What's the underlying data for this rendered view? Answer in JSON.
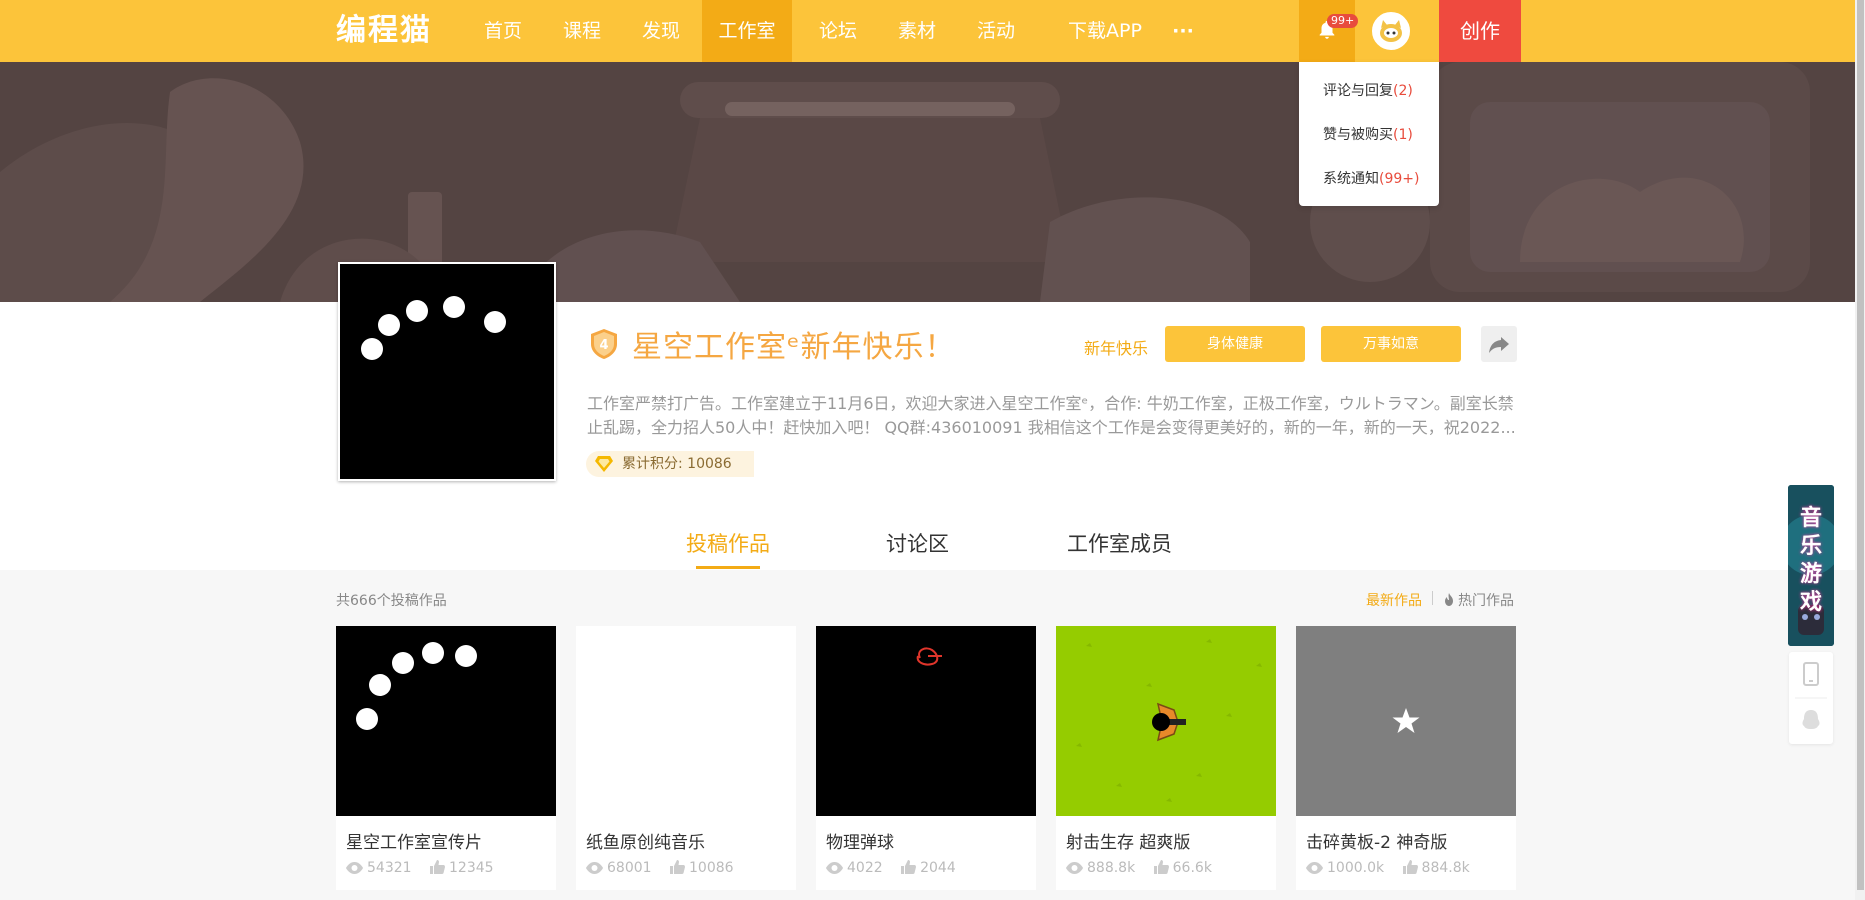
{
  "nav": {
    "logo": "编程猫",
    "items": [
      "首页",
      "课程",
      "发现",
      "工作室",
      "论坛",
      "素材",
      "活动",
      "下载APP",
      "···"
    ],
    "active_index": 3,
    "bell_badge": "99+",
    "create_label": "创作"
  },
  "notifications": [
    {
      "label": "评论与回复",
      "count": "(2)"
    },
    {
      "label": "赞与被购买",
      "count": "(1)"
    },
    {
      "label": "系统通知",
      "count": "(99+)"
    }
  ],
  "studio": {
    "level": "4",
    "title": "星空工作室ᵉ新年快乐！",
    "tag_plain": "新年快乐",
    "tag_buttons": [
      "身体健康",
      "万事如意"
    ],
    "description": [
      "工作室严禁打广告。工作室建立于11月6日，欢迎大家进入星空工作室ᵉ，合作: 牛奶工作室，正极工作室，ウルトラマン。副室长禁",
      "止乱踢，全力招人50人中！赶快加入吧！ QQ群:436010091 我相信这个工作是会变得更美好的，新的一年，新的一天，祝2022..."
    ],
    "points": "累计积分: 10086"
  },
  "tabs": [
    "投稿作品",
    "讨论区",
    "工作室成员"
  ],
  "works": {
    "count_label": "共666个投稿作品",
    "sort_latest": "最新作品",
    "sort_hot": "热门作品",
    "items": [
      {
        "title": "星空工作室宣传片",
        "views": "54321",
        "likes": "12345"
      },
      {
        "title": "纸鱼原创纯音乐",
        "views": "68001",
        "likes": "10086"
      },
      {
        "title": "物理弹球",
        "views": "4022",
        "likes": "2044"
      },
      {
        "title": "射击生存 超爽版",
        "views": "888.8k",
        "likes": "66.6k"
      },
      {
        "title": "击碎黄板-2 神奇版",
        "views": "1000.0k",
        "likes": "884.8k"
      }
    ]
  },
  "float_ad": "音乐游戏",
  "colors": {
    "brand": "#fcc43a",
    "brand_dark": "#f3ab16",
    "create": "#ef4a3f",
    "banner": "#544442"
  }
}
